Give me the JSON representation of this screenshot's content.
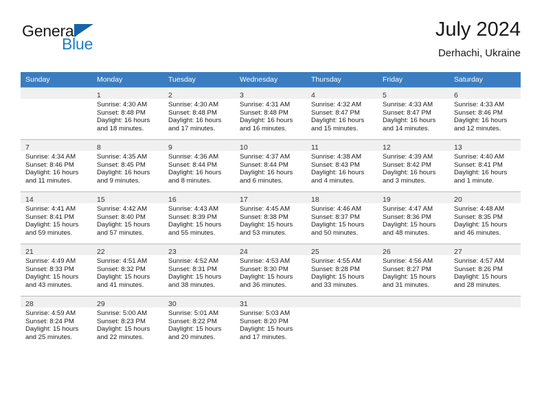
{
  "brand": {
    "name_top": "General",
    "name_bottom": "Blue",
    "color_blue": "#1d7fc4",
    "triangle_color": "#1565a8",
    "triangle_icon": "triangle-icon"
  },
  "header": {
    "title": "July 2024",
    "subtitle": "Derhachi, Ukraine"
  },
  "theme": {
    "header_row_bg": "#3b7dc0",
    "header_row_text": "#ffffff",
    "daynum_bg": "#f0f0f0",
    "grid_line": "#b9b9b9"
  },
  "weekdays": [
    "Sunday",
    "Monday",
    "Tuesday",
    "Wednesday",
    "Thursday",
    "Friday",
    "Saturday"
  ],
  "weeks": [
    [
      {
        "day": "",
        "sunrise": "",
        "sunset": "",
        "daylight1": "",
        "daylight2": "",
        "empty": true
      },
      {
        "day": "1",
        "sunrise": "Sunrise: 4:30 AM",
        "sunset": "Sunset: 8:48 PM",
        "daylight1": "Daylight: 16 hours",
        "daylight2": "and 18 minutes."
      },
      {
        "day": "2",
        "sunrise": "Sunrise: 4:30 AM",
        "sunset": "Sunset: 8:48 PM",
        "daylight1": "Daylight: 16 hours",
        "daylight2": "and 17 minutes."
      },
      {
        "day": "3",
        "sunrise": "Sunrise: 4:31 AM",
        "sunset": "Sunset: 8:48 PM",
        "daylight1": "Daylight: 16 hours",
        "daylight2": "and 16 minutes."
      },
      {
        "day": "4",
        "sunrise": "Sunrise: 4:32 AM",
        "sunset": "Sunset: 8:47 PM",
        "daylight1": "Daylight: 16 hours",
        "daylight2": "and 15 minutes."
      },
      {
        "day": "5",
        "sunrise": "Sunrise: 4:33 AM",
        "sunset": "Sunset: 8:47 PM",
        "daylight1": "Daylight: 16 hours",
        "daylight2": "and 14 minutes."
      },
      {
        "day": "6",
        "sunrise": "Sunrise: 4:33 AM",
        "sunset": "Sunset: 8:46 PM",
        "daylight1": "Daylight: 16 hours",
        "daylight2": "and 12 minutes."
      }
    ],
    [
      {
        "day": "7",
        "sunrise": "Sunrise: 4:34 AM",
        "sunset": "Sunset: 8:46 PM",
        "daylight1": "Daylight: 16 hours",
        "daylight2": "and 11 minutes."
      },
      {
        "day": "8",
        "sunrise": "Sunrise: 4:35 AM",
        "sunset": "Sunset: 8:45 PM",
        "daylight1": "Daylight: 16 hours",
        "daylight2": "and 9 minutes."
      },
      {
        "day": "9",
        "sunrise": "Sunrise: 4:36 AM",
        "sunset": "Sunset: 8:44 PM",
        "daylight1": "Daylight: 16 hours",
        "daylight2": "and 8 minutes."
      },
      {
        "day": "10",
        "sunrise": "Sunrise: 4:37 AM",
        "sunset": "Sunset: 8:44 PM",
        "daylight1": "Daylight: 16 hours",
        "daylight2": "and 6 minutes."
      },
      {
        "day": "11",
        "sunrise": "Sunrise: 4:38 AM",
        "sunset": "Sunset: 8:43 PM",
        "daylight1": "Daylight: 16 hours",
        "daylight2": "and 4 minutes."
      },
      {
        "day": "12",
        "sunrise": "Sunrise: 4:39 AM",
        "sunset": "Sunset: 8:42 PM",
        "daylight1": "Daylight: 16 hours",
        "daylight2": "and 3 minutes."
      },
      {
        "day": "13",
        "sunrise": "Sunrise: 4:40 AM",
        "sunset": "Sunset: 8:41 PM",
        "daylight1": "Daylight: 16 hours",
        "daylight2": "and 1 minute."
      }
    ],
    [
      {
        "day": "14",
        "sunrise": "Sunrise: 4:41 AM",
        "sunset": "Sunset: 8:41 PM",
        "daylight1": "Daylight: 15 hours",
        "daylight2": "and 59 minutes."
      },
      {
        "day": "15",
        "sunrise": "Sunrise: 4:42 AM",
        "sunset": "Sunset: 8:40 PM",
        "daylight1": "Daylight: 15 hours",
        "daylight2": "and 57 minutes."
      },
      {
        "day": "16",
        "sunrise": "Sunrise: 4:43 AM",
        "sunset": "Sunset: 8:39 PM",
        "daylight1": "Daylight: 15 hours",
        "daylight2": "and 55 minutes."
      },
      {
        "day": "17",
        "sunrise": "Sunrise: 4:45 AM",
        "sunset": "Sunset: 8:38 PM",
        "daylight1": "Daylight: 15 hours",
        "daylight2": "and 53 minutes."
      },
      {
        "day": "18",
        "sunrise": "Sunrise: 4:46 AM",
        "sunset": "Sunset: 8:37 PM",
        "daylight1": "Daylight: 15 hours",
        "daylight2": "and 50 minutes."
      },
      {
        "day": "19",
        "sunrise": "Sunrise: 4:47 AM",
        "sunset": "Sunset: 8:36 PM",
        "daylight1": "Daylight: 15 hours",
        "daylight2": "and 48 minutes."
      },
      {
        "day": "20",
        "sunrise": "Sunrise: 4:48 AM",
        "sunset": "Sunset: 8:35 PM",
        "daylight1": "Daylight: 15 hours",
        "daylight2": "and 46 minutes."
      }
    ],
    [
      {
        "day": "21",
        "sunrise": "Sunrise: 4:49 AM",
        "sunset": "Sunset: 8:33 PM",
        "daylight1": "Daylight: 15 hours",
        "daylight2": "and 43 minutes."
      },
      {
        "day": "22",
        "sunrise": "Sunrise: 4:51 AM",
        "sunset": "Sunset: 8:32 PM",
        "daylight1": "Daylight: 15 hours",
        "daylight2": "and 41 minutes."
      },
      {
        "day": "23",
        "sunrise": "Sunrise: 4:52 AM",
        "sunset": "Sunset: 8:31 PM",
        "daylight1": "Daylight: 15 hours",
        "daylight2": "and 38 minutes."
      },
      {
        "day": "24",
        "sunrise": "Sunrise: 4:53 AM",
        "sunset": "Sunset: 8:30 PM",
        "daylight1": "Daylight: 15 hours",
        "daylight2": "and 36 minutes."
      },
      {
        "day": "25",
        "sunrise": "Sunrise: 4:55 AM",
        "sunset": "Sunset: 8:28 PM",
        "daylight1": "Daylight: 15 hours",
        "daylight2": "and 33 minutes."
      },
      {
        "day": "26",
        "sunrise": "Sunrise: 4:56 AM",
        "sunset": "Sunset: 8:27 PM",
        "daylight1": "Daylight: 15 hours",
        "daylight2": "and 31 minutes."
      },
      {
        "day": "27",
        "sunrise": "Sunrise: 4:57 AM",
        "sunset": "Sunset: 8:26 PM",
        "daylight1": "Daylight: 15 hours",
        "daylight2": "and 28 minutes."
      }
    ],
    [
      {
        "day": "28",
        "sunrise": "Sunrise: 4:59 AM",
        "sunset": "Sunset: 8:24 PM",
        "daylight1": "Daylight: 15 hours",
        "daylight2": "and 25 minutes."
      },
      {
        "day": "29",
        "sunrise": "Sunrise: 5:00 AM",
        "sunset": "Sunset: 8:23 PM",
        "daylight1": "Daylight: 15 hours",
        "daylight2": "and 22 minutes."
      },
      {
        "day": "30",
        "sunrise": "Sunrise: 5:01 AM",
        "sunset": "Sunset: 8:22 PM",
        "daylight1": "Daylight: 15 hours",
        "daylight2": "and 20 minutes."
      },
      {
        "day": "31",
        "sunrise": "Sunrise: 5:03 AM",
        "sunset": "Sunset: 8:20 PM",
        "daylight1": "Daylight: 15 hours",
        "daylight2": "and 17 minutes."
      },
      {
        "day": "",
        "sunrise": "",
        "sunset": "",
        "daylight1": "",
        "daylight2": "",
        "empty": true
      },
      {
        "day": "",
        "sunrise": "",
        "sunset": "",
        "daylight1": "",
        "daylight2": "",
        "empty": true
      },
      {
        "day": "",
        "sunrise": "",
        "sunset": "",
        "daylight1": "",
        "daylight2": "",
        "empty": true
      }
    ]
  ]
}
